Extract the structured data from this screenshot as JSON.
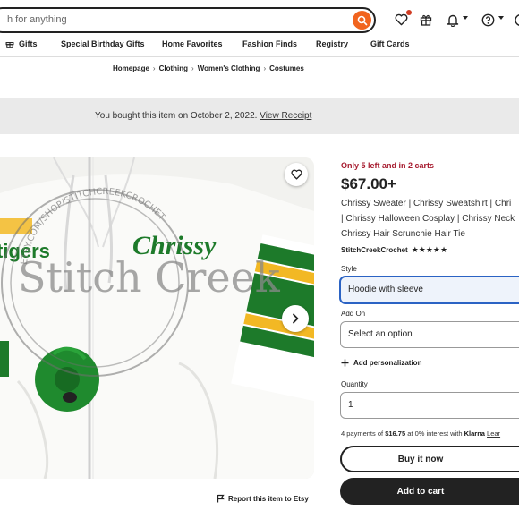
{
  "header": {
    "search_placeholder": "Search for anything",
    "search_visible_text": "h for anything"
  },
  "nav": {
    "items": [
      "Gifts",
      "Special Birthday Gifts",
      "Home Favorites",
      "Fashion Finds",
      "Registry",
      "Gift Cards"
    ]
  },
  "breadcrumb": [
    "Homepage",
    "Clothing",
    "Women's Clothing",
    "Costumes"
  ],
  "banner": {
    "text": "You bought this item on October 2, 2022.",
    "link": "View Receipt"
  },
  "image": {
    "watermark_text": "Stitch Creek",
    "watermark_url": "ETSY.COM/SHOP/STITCHCREEKCROCHET",
    "left_print": "tigers",
    "right_print": "Chrissy"
  },
  "report_link": "Report this item to Etsy",
  "listing": {
    "stock_notice": "Only 5 left and in 2 carts",
    "price": "$67.00+",
    "title_lines": [
      "Chrissy Sweater | Chrissy Sweatshirt | Chri",
      "| Chrissy Halloween Cosplay | Chrissy Neck",
      "Chrissy Hair Scrunchie Hair Tie"
    ],
    "shop_name": "StitchCreekCrochet",
    "stars": "★★★★★",
    "style_label": "Style",
    "style_value": "Hoodie with sleeve",
    "addon_label": "Add On",
    "addon_value": "Select an option",
    "personalization": "Add personalization",
    "quantity_label": "Quantity",
    "quantity_value": "1",
    "klarna_prefix": "4 payments of ",
    "klarna_amount": "$16.75",
    "klarna_suffix": " at 0% interest with ",
    "klarna_brand": "Klarna",
    "klarna_learn": "Lear",
    "buy_now": "Buy it now",
    "add_to_cart": "Add to cart"
  },
  "colors": {
    "etsy_orange": "#f1641e",
    "stock_red": "#a61a2e",
    "focus_blue": "#2b63c4",
    "dark": "#222222",
    "banner_gray": "#eaeaea",
    "jersey_green": "#1d7a2a",
    "jersey_gold": "#f2b824"
  },
  "icons": [
    "search-icon",
    "heart-icon",
    "gift-icon",
    "bell-icon",
    "help-icon",
    "cart-icon",
    "flag-icon",
    "plus-icon",
    "chevron-right-icon"
  ]
}
